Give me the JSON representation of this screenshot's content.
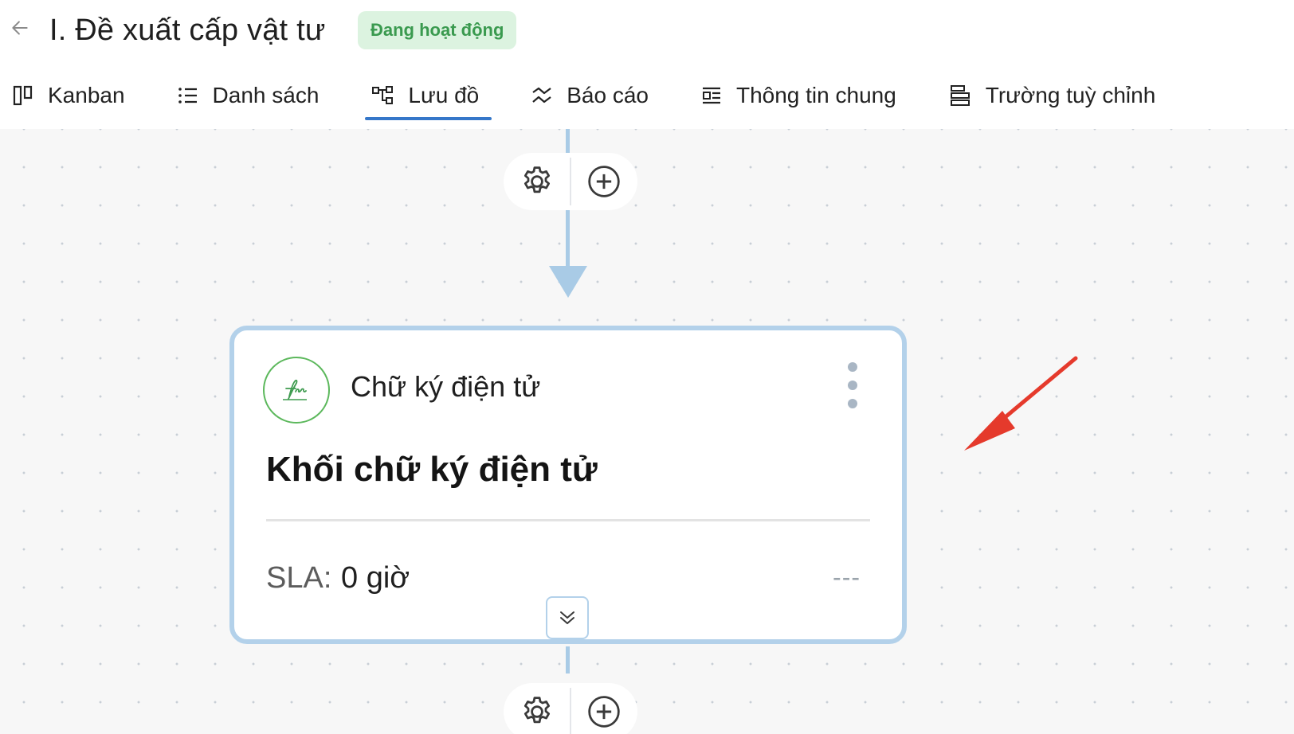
{
  "header": {
    "title": "I. Đề xuất cấp vật tư",
    "status": "Đang hoạt động",
    "back_icon": "arrow-left-icon"
  },
  "tabs": [
    {
      "label": "Kanban",
      "icon": "kanban-icon",
      "active": false
    },
    {
      "label": "Danh sách",
      "icon": "list-icon",
      "active": false
    },
    {
      "label": "Lưu đồ",
      "icon": "flowchart-icon",
      "active": true
    },
    {
      "label": "Báo cáo",
      "icon": "report-icon",
      "active": false
    },
    {
      "label": "Thông tin chung",
      "icon": "info-icon",
      "active": false
    },
    {
      "label": "Trường tuỳ chỉnh",
      "icon": "custom-fields-icon",
      "active": false
    }
  ],
  "node": {
    "type_label": "Chữ ký điện tử",
    "title": "Khối chữ ký điện tử",
    "sla_label": "SLA:",
    "sla_value": "0 giờ",
    "assignee": "---",
    "icon": "signature-icon"
  },
  "colors": {
    "accent": "#3577c9",
    "connector": "#a9cbe6",
    "badge_bg": "#dcf3e0",
    "badge_text": "#3a9a4f",
    "annotation": "#e53a2c"
  }
}
